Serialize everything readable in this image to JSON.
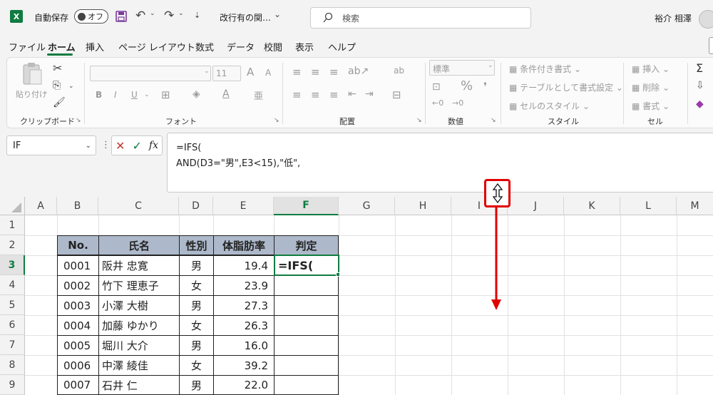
{
  "titlebar": {
    "logo": "X",
    "autosave_label": "自動保存",
    "autosave_state": "オフ",
    "filename": "改行有の関…",
    "search_placeholder": "検索",
    "user": "裕介 相澤"
  },
  "menu": [
    "ファイル",
    "ホーム",
    "挿入",
    "ページ レイアウト",
    "数式",
    "データ",
    "校閲",
    "表示",
    "ヘルプ"
  ],
  "ribbon": {
    "clipboard": {
      "paste": "貼り付け",
      "group": "クリップボード"
    },
    "font": {
      "size": "11",
      "bold": "B",
      "italic": "I",
      "underline": "U",
      "grow": "A",
      "shrink": "A",
      "group": "フォント"
    },
    "alignment": {
      "group": "配置"
    },
    "number": {
      "format": "標準",
      "percent": "%",
      "group": "数値"
    },
    "styles": {
      "conditional": "条件付き書式",
      "table": "テーブルとして書式設定",
      "cell_style": "セルのスタイル",
      "group": "スタイル"
    },
    "cells": {
      "insert": "挿入",
      "delete": "削除",
      "format": "書式",
      "group": "セル"
    }
  },
  "formula": {
    "namebox": "IF",
    "fx": "fx",
    "line1": "=IFS(",
    "line2": "AND(D3=\"男\",E3<15),\"低\","
  },
  "columns": [
    "A",
    "B",
    "C",
    "D",
    "E",
    "F",
    "G",
    "H",
    "I",
    "J",
    "K",
    "L",
    "M"
  ],
  "rows": [
    "1",
    "2",
    "3",
    "4",
    "5",
    "6",
    "7",
    "8",
    "9"
  ],
  "table": {
    "headers": [
      "No.",
      "氏名",
      "性別",
      "体脂肪率",
      "判定"
    ],
    "rows": [
      [
        "0001",
        "阪井 忠寛",
        "男",
        "19.4"
      ],
      [
        "0002",
        "竹下 理恵子",
        "女",
        "23.9"
      ],
      [
        "0003",
        "小澤 大樹",
        "男",
        "27.3"
      ],
      [
        "0004",
        "加藤 ゆかり",
        "女",
        "26.3"
      ],
      [
        "0005",
        "堀川 大介",
        "男",
        "16.0"
      ],
      [
        "0006",
        "中澤 綾佳",
        "女",
        "39.2"
      ],
      [
        "0007",
        "石井 仁",
        "男",
        "22.0"
      ]
    ]
  },
  "active_cell_text": "=IFS(",
  "colors": {
    "excel_green": "#107c41",
    "header_fill": "#adb9ca",
    "annotation_red": "#e00000"
  }
}
